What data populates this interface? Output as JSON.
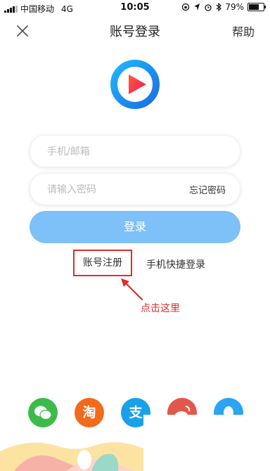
{
  "status_bar": {
    "carrier": "中国移动",
    "network": "4G",
    "time": "10:05",
    "battery": "79%",
    "battery_level": 0.79
  },
  "nav": {
    "title": "账号登录",
    "help": "帮助"
  },
  "form": {
    "phone_placeholder": "手机/邮箱",
    "password_placeholder": "请输入密码",
    "forgot_password": "忘记密码",
    "login_button": "登录",
    "register_link": "账号注册",
    "quick_login": "手机快捷登录"
  },
  "annotation": {
    "text": "点击这里"
  },
  "social": [
    {
      "name": "wechat-icon",
      "glyph": "",
      "color": "#3dbb4a"
    },
    {
      "name": "taobao-icon",
      "glyph": "淘",
      "color": "#f26a1b"
    },
    {
      "name": "alipay-icon",
      "glyph": "支",
      "color": "#1aa0e8"
    },
    {
      "name": "weibo-icon",
      "glyph": "",
      "color": "#e2574c"
    },
    {
      "name": "qq-icon",
      "glyph": "",
      "color": "#2aa4f4"
    }
  ],
  "colors": {
    "accent": "#7ec0f8",
    "annotation": "#d9302c"
  }
}
